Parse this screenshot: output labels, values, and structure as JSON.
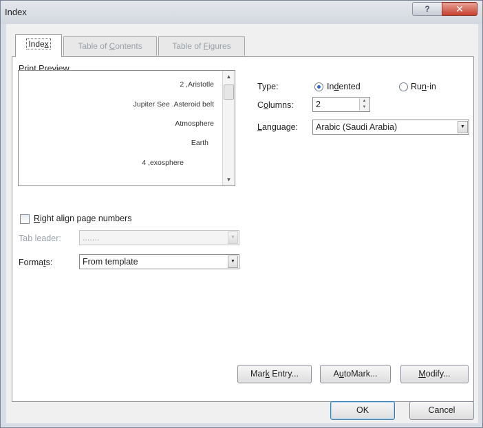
{
  "dialog": {
    "title": "Index",
    "help_label": "?",
    "close_label": "✕"
  },
  "tabs": [
    {
      "label_pre": "Inde",
      "label_key": "x",
      "label_post": "",
      "active": true
    },
    {
      "label_pre": "Table of ",
      "label_key": "C",
      "label_post": "ontents",
      "active": false
    },
    {
      "label_pre": "Table of ",
      "label_key": "F",
      "label_post": "igures",
      "active": false
    }
  ],
  "print_preview": {
    "label_pre": "Print Pre",
    "label_key": "v",
    "label_post": "iew",
    "lines": [
      "2 ,Aristotle",
      "Jupiter See .Asteroid belt",
      "Atmosphere",
      "Earth",
      "4 ,exosphere"
    ]
  },
  "type": {
    "label": "Type:",
    "indented_pre": "In",
    "indented_key": "d",
    "indented_post": "ented",
    "runin_pre": "Ru",
    "runin_key": "n",
    "runin_post": "-in",
    "selected": "Indented"
  },
  "columns": {
    "label_pre": "C",
    "label_key": "o",
    "label_post": "lumns:",
    "value": "2"
  },
  "language": {
    "label_pre": "",
    "label_key": "L",
    "label_post": "anguage:",
    "value": "Arabic (Saudi Arabia)"
  },
  "right_align": {
    "label_pre": "",
    "label_key": "R",
    "label_post": "ight align page numbers",
    "checked": false
  },
  "tab_leader": {
    "label": "Tab leader:",
    "value": ".......",
    "enabled": false
  },
  "formats": {
    "label_pre": "Forma",
    "label_key": "t",
    "label_post": "s:",
    "value": "From template"
  },
  "buttons": {
    "mark_entry_pre": "Mar",
    "mark_entry_key": "k",
    "mark_entry_post": " Entry...",
    "automark_pre": "A",
    "automark_key": "u",
    "automark_post": "toMark...",
    "modify_pre": "",
    "modify_key": "M",
    "modify_post": "odify...",
    "ok": "OK",
    "cancel": "Cancel"
  },
  "icons": {
    "scroll_up": "triangle-up",
    "scroll_down": "triangle-down",
    "dropdown": "triangle-down",
    "spin_up": "triangle-up",
    "spin_down": "triangle-down"
  },
  "colors": {
    "title_bar": "#d3d8e0",
    "close_button": "#c7402d",
    "radio_dot": "#2a6bd0",
    "default_button_border": "#3c7fb1"
  }
}
